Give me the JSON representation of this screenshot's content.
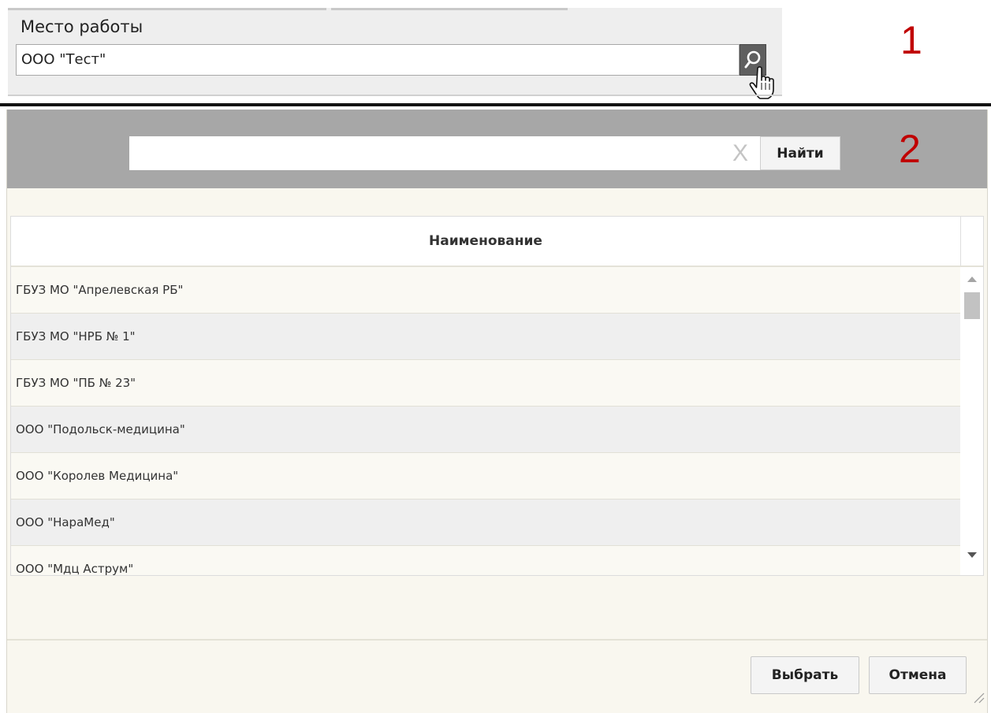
{
  "workplace": {
    "label": "Место работы",
    "value": "ООО \"Тест\""
  },
  "steps": {
    "first": "1",
    "second": "2"
  },
  "search": {
    "value": "",
    "clear_glyph": "X",
    "find_label": "Найти"
  },
  "table": {
    "column_header": "Наименование",
    "rows": [
      "ГБУЗ МО \"Апрелевская РБ\"",
      "ГБУЗ МО \"НРБ № 1\"",
      "ГБУЗ МО \"ПБ № 23\"",
      "ООО \"Подольск-медицина\"",
      "ООО \"Королев Медицина\"",
      "ООО \"НараМед\"",
      "ООО \"Мдц Аструм\""
    ]
  },
  "buttons": {
    "select": "Выбрать",
    "cancel": "Отмена"
  },
  "icons": {
    "lookup": "search-icon",
    "cursor": "hand-pointer-icon",
    "clear": "clear-icon",
    "resize": "resize-grip-icon"
  },
  "colors": {
    "step_number": "#c00000",
    "search_bar": "#a7a7a7",
    "dialog_background": "#f9f7ef",
    "separator": "#111111"
  }
}
